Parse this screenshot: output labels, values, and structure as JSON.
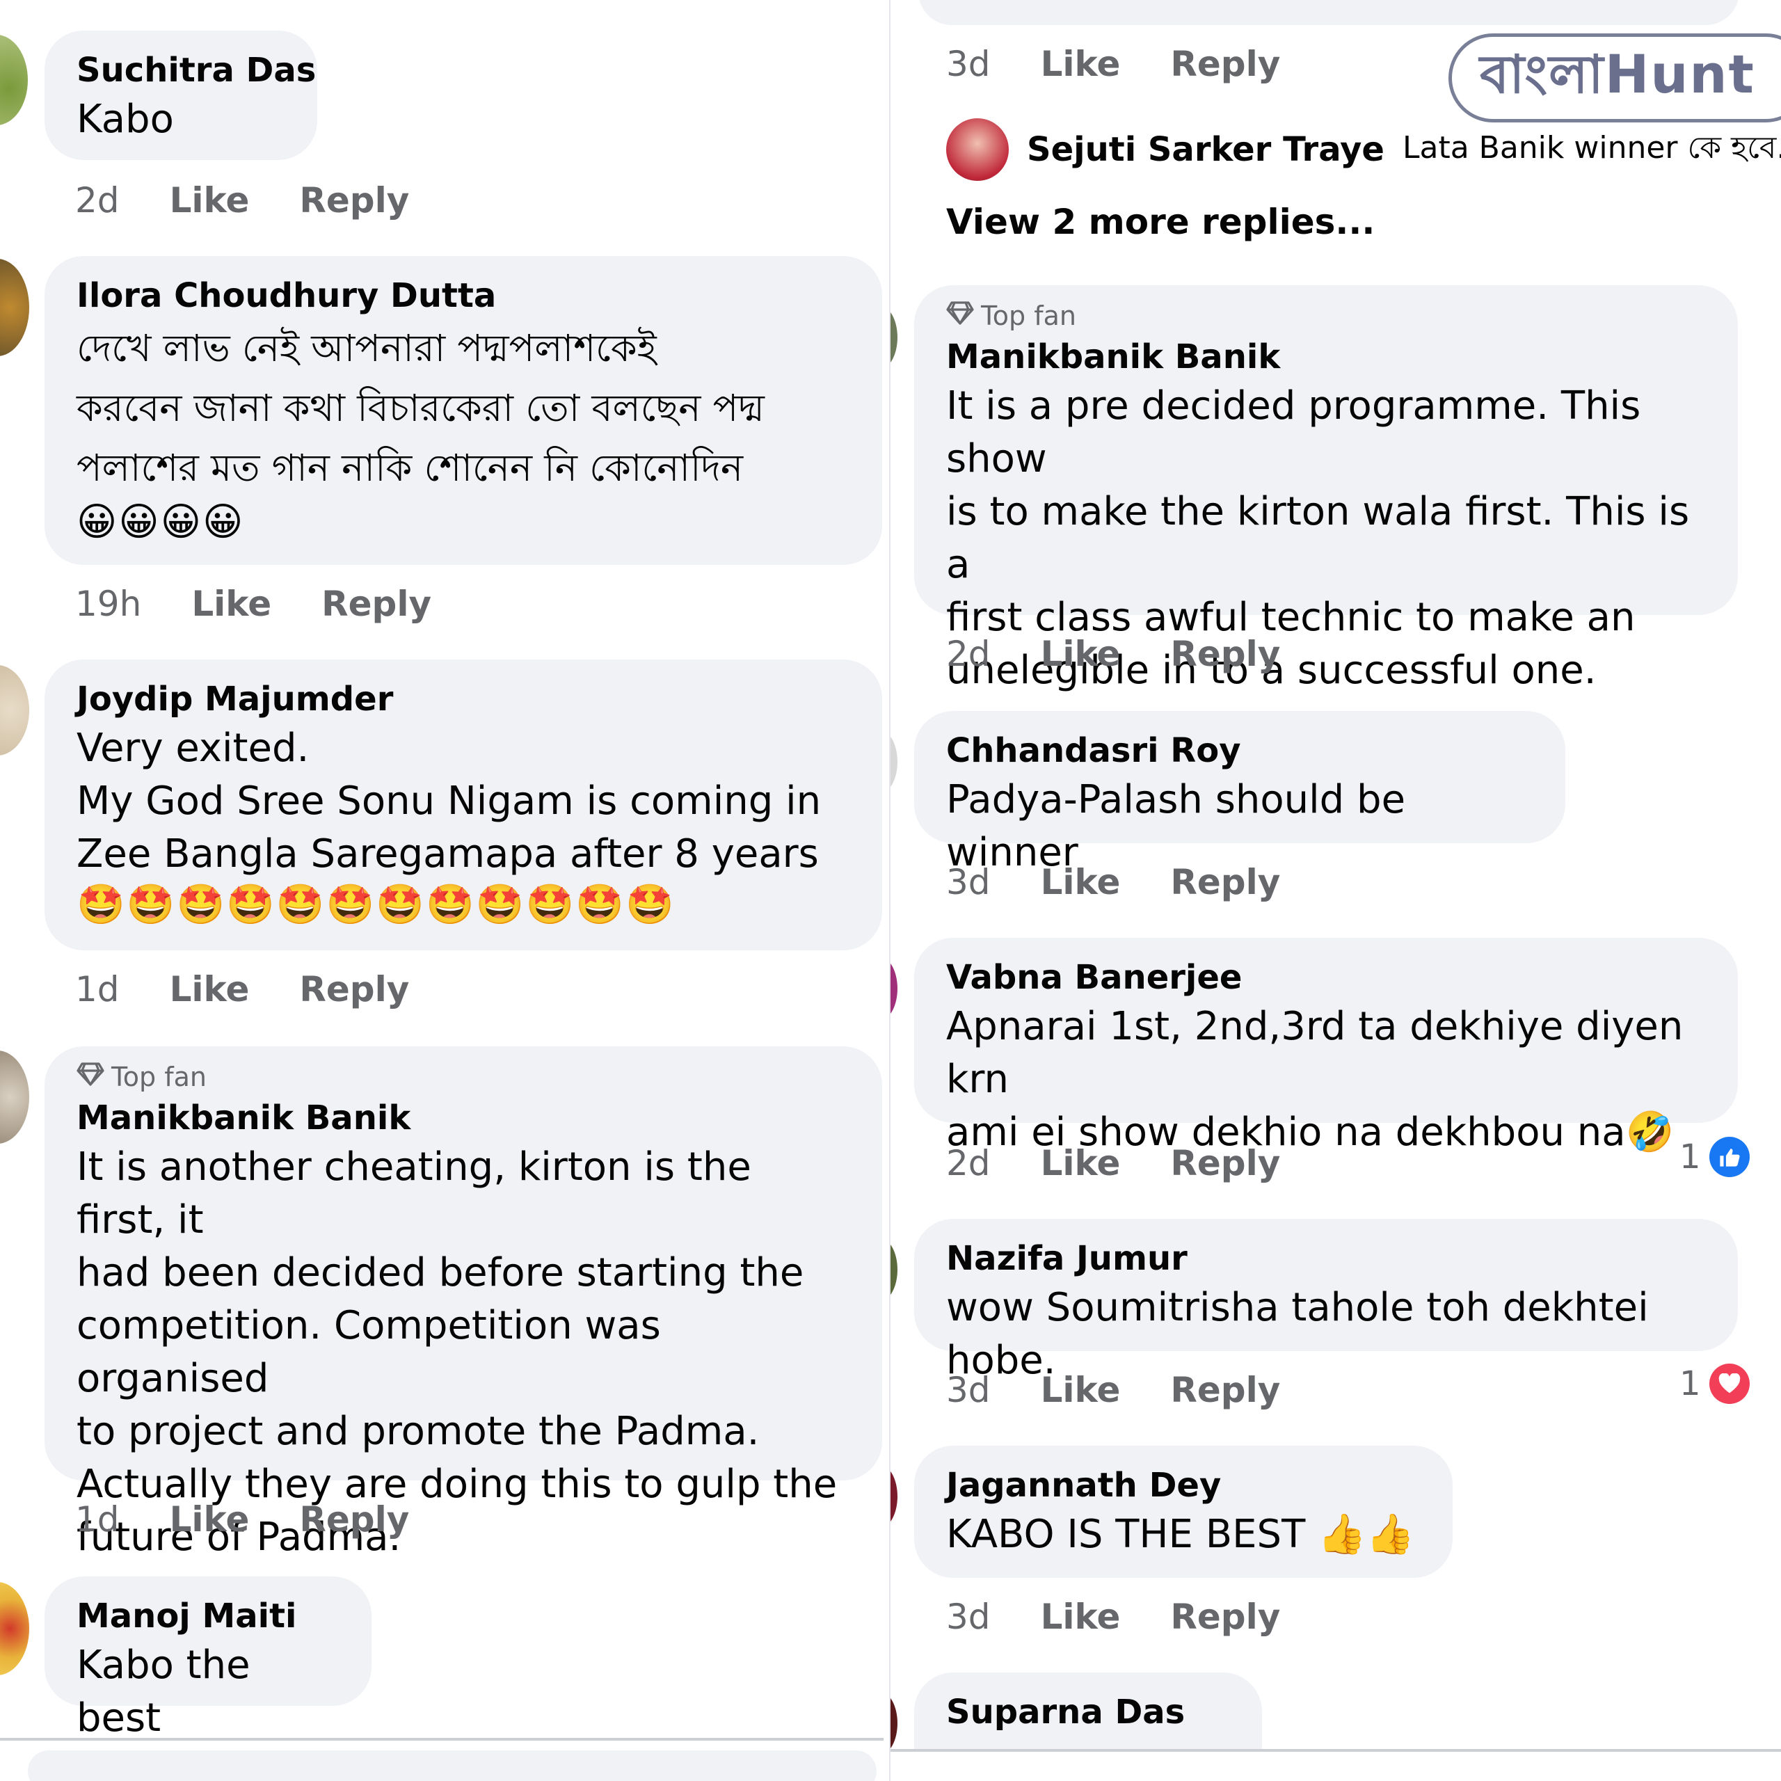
{
  "colors": {
    "bubble": "#f0f2f5",
    "meta": "#65676b",
    "name": "#050505",
    "like_blue": "#1877f2",
    "love_red": "#f33e58",
    "logo": "#6b6f8e"
  },
  "icons": {
    "top_fan": "diamond-icon",
    "like_reaction": "thumbs-up-icon",
    "love_reaction": "heart-icon"
  },
  "actions": {
    "like": "Like",
    "reply": "Reply"
  },
  "logo": {
    "text": "বাংলাHunt"
  },
  "left": [
    {
      "name": "Suchitra Das",
      "text": "Kabo",
      "time": "2d"
    },
    {
      "name": "Ilora Choudhury Dutta",
      "text": "দেখে লাভ নেই আপনারা পদ্মপলাশকেই\nকরবেন জানা কথা বিচারকেরা তো বলছেন পদ্ম\nপলাশের মত গান নাকি শোনেন নি কোনোদিন",
      "emojis": "😀😀😀😀",
      "time": "19h"
    },
    {
      "name": "Joydip Majumder",
      "text": "Very exited.\nMy God Sree Sonu Nigam is coming in\nZee Bangla Saregamapa after 8 years",
      "emojis": "🤩🤩🤩🤩🤩🤩🤩🤩🤩🤩🤩🤩",
      "time": "1d"
    },
    {
      "badge": "Top fan",
      "name": "Manikbanik Banik",
      "text": "It is another cheating, kirton is the first, it\nhad been decided before starting the\ncompetition. Competition was organised\nto project and promote the Padma.\nActually they are doing this to gulp the\nfuture of Padma.",
      "time": "1d"
    },
    {
      "name": "Manoj Maiti",
      "text": "Kabo the best"
    }
  ],
  "right_top": {
    "time": "3d",
    "reply_preview": {
      "name": "Sejuti Sarker Traye",
      "text": "Lata Banik winner কে হবে..."
    },
    "view_more": "View 2 more replies..."
  },
  "right": [
    {
      "badge": "Top fan",
      "name": "Manikbanik Banik",
      "text": "It is a pre decided programme. This show\nis to make the kirton wala first. This is a\nfirst class awful technic to make an\nunelegible in to a successful one.",
      "time": "2d"
    },
    {
      "name": "Chhandasri Roy",
      "text": "Padya-Palash should be winner",
      "time": "3d"
    },
    {
      "name": "Vabna Banerjee",
      "text": "Apnarai 1st, 2nd,3rd ta dekhiye diyen krn\nami ei show dekhio na dekhbou na🤣",
      "time": "2d",
      "reaction_count": "1"
    },
    {
      "name": "Nazifa Jumur",
      "text": "wow Soumitrisha tahole toh dekhtei hobe.",
      "time": "3d",
      "reaction_count": "1"
    },
    {
      "name": "Jagannath Dey",
      "text": "KABO IS THE BEST 👍👍",
      "time": "3d"
    },
    {
      "name": "Suparna Das"
    }
  ]
}
